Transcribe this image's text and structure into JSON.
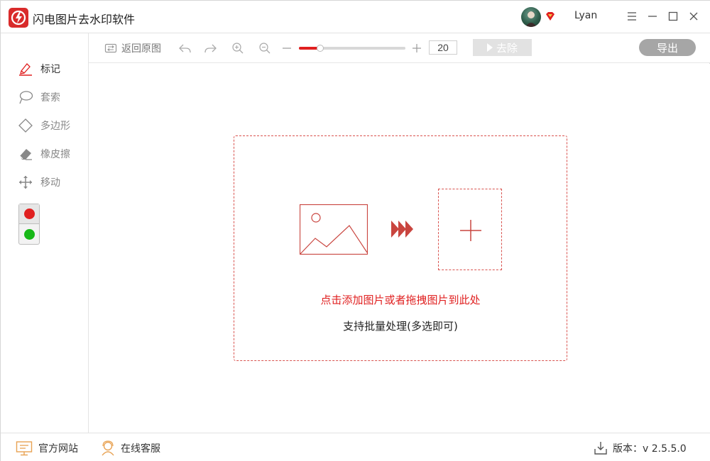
{
  "app": {
    "title": "闪电图片去水印软件",
    "brand_color": "#d92b2b",
    "username": "Lyan"
  },
  "toolbar": {
    "restore_label": "返回原图",
    "brush_size": "20",
    "brush_size_fraction": 0.2,
    "remove_label": "去除",
    "export_label": "导出",
    "accent_color": "#e02020"
  },
  "sidebar": {
    "tools": [
      {
        "label": "标记",
        "icon": "marker-icon",
        "active": true
      },
      {
        "label": "套索",
        "icon": "lasso-icon",
        "active": false
      },
      {
        "label": "多边形",
        "icon": "polygon-icon",
        "active": false
      },
      {
        "label": "橡皮擦",
        "icon": "eraser-icon",
        "active": false
      },
      {
        "label": "移动",
        "icon": "move-icon",
        "active": false
      }
    ],
    "colors": [
      "#e02020",
      "#18b818"
    ]
  },
  "dropzone": {
    "primary_hint": "点击添加图片或者拖拽图片到此处",
    "secondary_hint": "支持批量处理(多选即可)"
  },
  "footer": {
    "website_label": "官方网站",
    "support_label": "在线客服",
    "version_label": "版本：v 2.5.5.0"
  }
}
